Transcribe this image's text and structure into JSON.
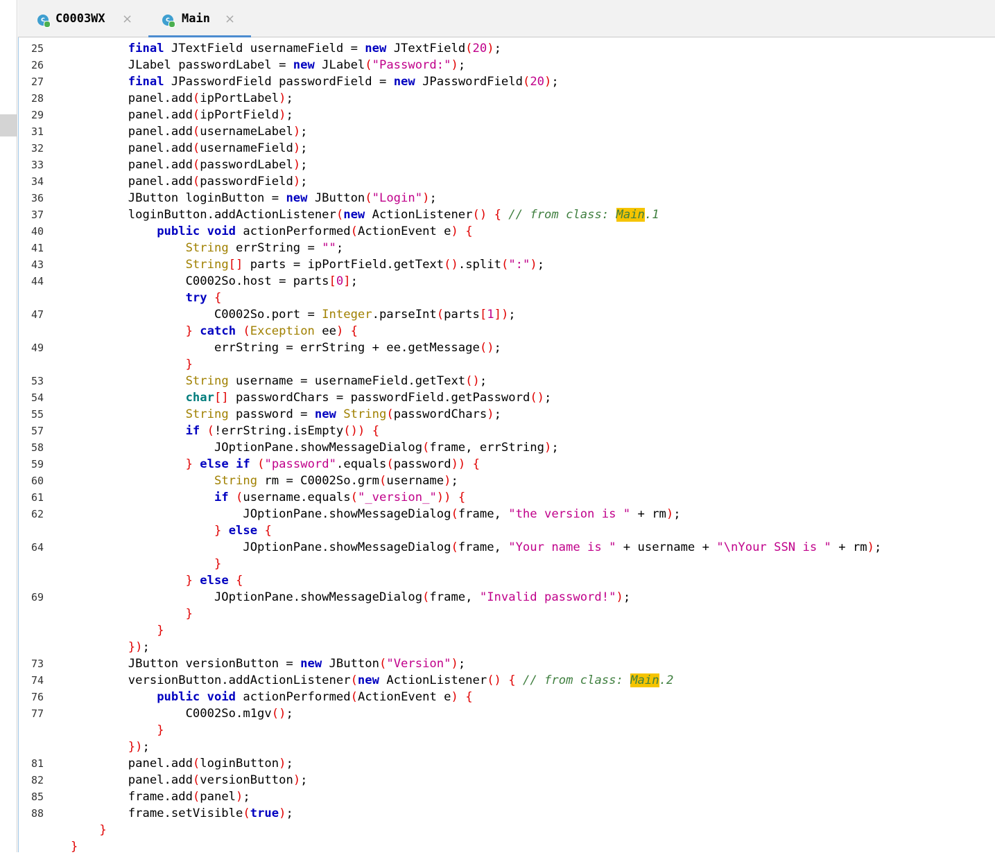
{
  "colors": {
    "keyword": "#0000c0",
    "type": "#a08000",
    "string": "#c0008a",
    "punctuation": "#e00000",
    "comment": "#3f7f3f",
    "highlight": "#f5c400",
    "tab_underline": "#4c8cd0"
  },
  "tabs": [
    {
      "label": "C0003WX",
      "icon": "java-class-icon",
      "active": false
    },
    {
      "label": "Main",
      "icon": "java-class-icon",
      "active": true
    }
  ],
  "editor": {
    "lines": [
      {
        "num": "25",
        "indent": 8,
        "text": "final JTextField usernameField = new JTextField(20);"
      },
      {
        "num": "26",
        "indent": 8,
        "text": "JLabel passwordLabel = new JLabel(\"Password:\");"
      },
      {
        "num": "27",
        "indent": 8,
        "text": "final JPasswordField passwordField = new JPasswordField(20);"
      },
      {
        "num": "28",
        "indent": 8,
        "text": "panel.add(ipPortLabel);"
      },
      {
        "num": "29",
        "indent": 8,
        "text": "panel.add(ipPortField);"
      },
      {
        "num": "31",
        "indent": 8,
        "text": "panel.add(usernameLabel);"
      },
      {
        "num": "32",
        "indent": 8,
        "text": "panel.add(usernameField);"
      },
      {
        "num": "33",
        "indent": 8,
        "text": "panel.add(passwordLabel);"
      },
      {
        "num": "34",
        "indent": 8,
        "text": "panel.add(passwordField);"
      },
      {
        "num": "36",
        "indent": 8,
        "text": "JButton loginButton = new JButton(\"Login\");"
      },
      {
        "num": "37",
        "indent": 8,
        "text": "loginButton.addActionListener(new ActionListener() { // from class: Main.1",
        "highlight": "Main"
      },
      {
        "num": "40",
        "indent": 12,
        "text": "public void actionPerformed(ActionEvent e) {"
      },
      {
        "num": "41",
        "indent": 16,
        "text": "String errString = \"\";"
      },
      {
        "num": "43",
        "indent": 16,
        "text": "String[] parts = ipPortField.getText().split(\":\");"
      },
      {
        "num": "44",
        "indent": 16,
        "text": "C0002So.host = parts[0];"
      },
      {
        "num": "",
        "indent": 16,
        "text": "try {"
      },
      {
        "num": "47",
        "indent": 20,
        "text": "C0002So.port = Integer.parseInt(parts[1]);"
      },
      {
        "num": "",
        "indent": 16,
        "text": "} catch (Exception ee) {"
      },
      {
        "num": "49",
        "indent": 20,
        "text": "errString = errString + ee.getMessage();"
      },
      {
        "num": "",
        "indent": 16,
        "text": "}"
      },
      {
        "num": "53",
        "indent": 16,
        "text": "String username = usernameField.getText();"
      },
      {
        "num": "54",
        "indent": 16,
        "text": "char[] passwordChars = passwordField.getPassword();"
      },
      {
        "num": "55",
        "indent": 16,
        "text": "String password = new String(passwordChars);"
      },
      {
        "num": "57",
        "indent": 16,
        "text": "if (!errString.isEmpty()) {"
      },
      {
        "num": "58",
        "indent": 20,
        "text": "JOptionPane.showMessageDialog(frame, errString);"
      },
      {
        "num": "59",
        "indent": 16,
        "text": "} else if (\"password\".equals(password)) {"
      },
      {
        "num": "60",
        "indent": 20,
        "text": "String rm = C0002So.grm(username);"
      },
      {
        "num": "61",
        "indent": 20,
        "text": "if (username.equals(\"_version_\")) {"
      },
      {
        "num": "62",
        "indent": 24,
        "text": "JOptionPane.showMessageDialog(frame, \"the version is \" + rm);"
      },
      {
        "num": "",
        "indent": 20,
        "text": "} else {"
      },
      {
        "num": "64",
        "indent": 24,
        "text": "JOptionPane.showMessageDialog(frame, \"Your name is \" + username + \"\\nYour SSN is \" + rm);"
      },
      {
        "num": "",
        "indent": 20,
        "text": "}"
      },
      {
        "num": "",
        "indent": 16,
        "text": "} else {"
      },
      {
        "num": "69",
        "indent": 20,
        "text": "JOptionPane.showMessageDialog(frame, \"Invalid password!\");"
      },
      {
        "num": "",
        "indent": 16,
        "text": "}"
      },
      {
        "num": "",
        "indent": 12,
        "text": "}"
      },
      {
        "num": "",
        "indent": 8,
        "text": "});"
      },
      {
        "num": "73",
        "indent": 8,
        "text": "JButton versionButton = new JButton(\"Version\");"
      },
      {
        "num": "74",
        "indent": 8,
        "text": "versionButton.addActionListener(new ActionListener() { // from class: Main.2",
        "highlight": "Main"
      },
      {
        "num": "76",
        "indent": 12,
        "text": "public void actionPerformed(ActionEvent e) {"
      },
      {
        "num": "77",
        "indent": 16,
        "text": "C0002So.m1gv();"
      },
      {
        "num": "",
        "indent": 12,
        "text": "}"
      },
      {
        "num": "",
        "indent": 8,
        "text": "});"
      },
      {
        "num": "81",
        "indent": 8,
        "text": "panel.add(loginButton);"
      },
      {
        "num": "82",
        "indent": 8,
        "text": "panel.add(versionButton);"
      },
      {
        "num": "85",
        "indent": 8,
        "text": "frame.add(panel);"
      },
      {
        "num": "88",
        "indent": 8,
        "text": "frame.setVisible(true);"
      },
      {
        "num": "",
        "indent": 4,
        "text": "}"
      },
      {
        "num": "",
        "indent": 0,
        "text": "}"
      }
    ]
  }
}
